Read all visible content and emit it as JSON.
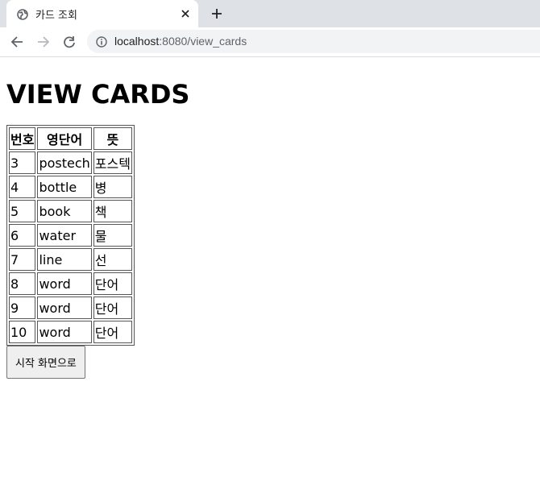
{
  "browser": {
    "tab_title": "카드 조회",
    "url_host": "localhost",
    "url_rest": ":8080/view_cards"
  },
  "page": {
    "heading": "VIEW CARDS",
    "table": {
      "headers": [
        "번호",
        "영단어",
        "뜻"
      ],
      "rows": [
        [
          "3",
          "postech",
          "포스텍"
        ],
        [
          "4",
          "bottle",
          "병"
        ],
        [
          "5",
          "book",
          "책"
        ],
        [
          "6",
          "water",
          "물"
        ],
        [
          "7",
          "line",
          "선"
        ],
        [
          "8",
          "word",
          "단어"
        ],
        [
          "9",
          "word",
          "단어"
        ],
        [
          "10",
          "word",
          "단어"
        ]
      ]
    },
    "start_button_label": "시작 화면으로"
  }
}
